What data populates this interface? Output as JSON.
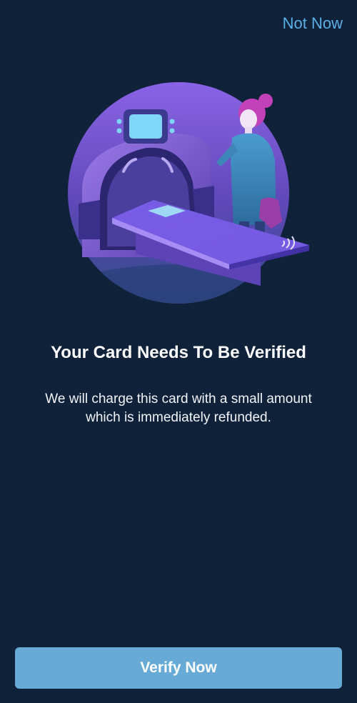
{
  "header": {
    "not_now_label": "Not Now"
  },
  "illustration": {
    "icon": "card-scanner-illustration",
    "colors": {
      "circle": "#6e52c8",
      "accent_purple": "#8a63e6",
      "screen": "#7fd6f7",
      "person_coat": "#3f86b8",
      "hair": "#c240b8"
    }
  },
  "content": {
    "title": "Your Card Needs To Be Verified",
    "message_line1": "We will charge this card with a small amount",
    "message_line2": "which is immediately refunded."
  },
  "footer": {
    "verify_label": "Verify Now"
  },
  "colors": {
    "background": "#10213a",
    "link": "#5ab0e6",
    "button": "#67aad6"
  }
}
